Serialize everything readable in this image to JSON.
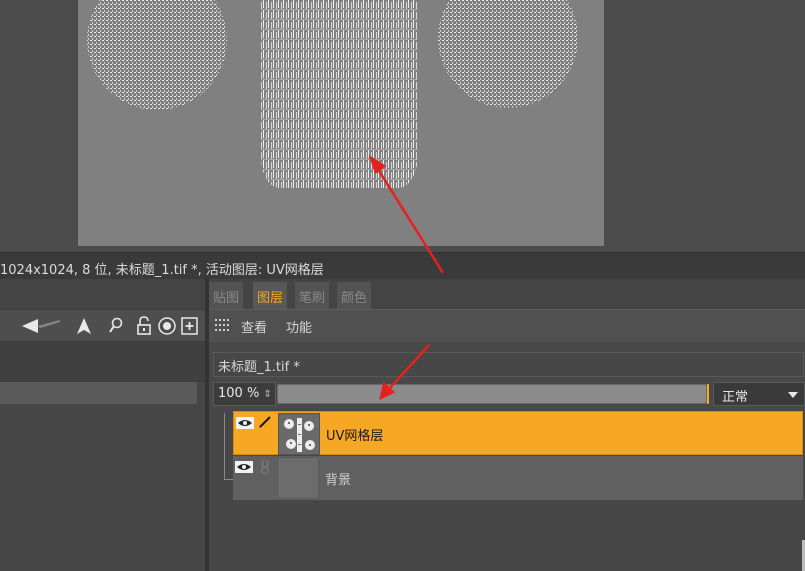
{
  "status": {
    "text": "1024x1024, 8 位, 未标题_1.tif *, 活动图层: UV网格层"
  },
  "tabs": [
    {
      "label": "贴图",
      "active": false
    },
    {
      "label": "图层",
      "active": true
    },
    {
      "label": "笔刷",
      "active": false
    },
    {
      "label": "颜色",
      "active": false
    }
  ],
  "subbar": {
    "view_label": "查看",
    "function_label": "功能"
  },
  "document": {
    "name": "未标题_1.tif *"
  },
  "opacity": {
    "value": "100 %",
    "stepper_glyph": "⇕",
    "level": 1.0
  },
  "blend_mode": {
    "selected": "正常"
  },
  "layers": [
    {
      "name": "UV网格层",
      "active": true
    },
    {
      "name": "背景",
      "active": false
    }
  ],
  "colors": {
    "accent": "#f6a724",
    "annotation": "#e5211f",
    "canvas": "#808080"
  },
  "icons": {
    "toolbar": [
      "arrow-left-icon",
      "arrow-up-icon",
      "magnifier-icon",
      "lock-icon",
      "target-icon",
      "add-layer-icon"
    ],
    "layer": [
      "eye-icon",
      "brush-icon",
      "chain-icon"
    ]
  }
}
